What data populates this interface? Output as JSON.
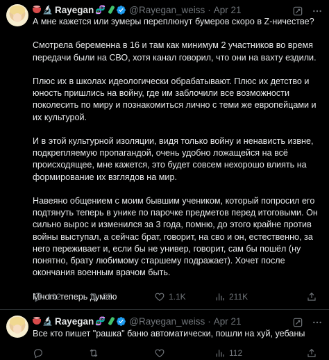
{
  "tweet1": {
    "display_name": "Rayegan",
    "handle": "@Rayegan_weiss",
    "separator": "·",
    "date": "Apr 21",
    "paragraphs": [
      "А мне кажется или зумеры переплюнут бумеров скоро в Z-ничестве?",
      "Смотрела беременна в 16 и там как минимум 2 участников во время передачи были на СВО, хотя канал говорил, что они на вахту ездили.",
      "Плюс их в школах идеологически обрабатывают. Плюс их детство и юность пришлись на войну, где им заблочили все возможности поколесить по миру и познакомиться лично с теми же европейцами и их культурой.",
      "И в этой культурной изоляции, видя только войну и ненависть извне, подкрепляемую пропагандой, очень удобно ложащейся на всё происходящее, мне кажется, это будет совсем нехорошо влиять на формирование их взглядов на мир.",
      "Навеяно общением с моим бывшим учеником, который попросил его подтянуть теперь в унике по парочке предметов перед итоговыми. Он сильно вырос и изменился за 3 года, помню, до этого крайне против войны выступал, а сейчас брат, говорит, на сво и он, естественно, за него переживает и, если бы не универ, говорит, сам бы пошёл (ну понятно, брату любимому старшему подражает). Хочет после окончания военным врачом быть.",
      "Много теперь думаю"
    ],
    "replies": "192",
    "reposts": "57",
    "likes": "1.1K",
    "views": "211K"
  },
  "tweet2": {
    "display_name": "Rayegan",
    "handle": "@Rayegan_weiss",
    "separator": "·",
    "date": "Apr 21",
    "text": "Все кто пишет \"рашка\" баню автоматически, пошли на хуй, уебаны",
    "replies": "",
    "reposts": "",
    "likes": "",
    "views": "112"
  },
  "icons": {
    "name_emojis": [
      "bowl-emoji",
      "microscope-emoji",
      "dna-emoji",
      "test-tube-emoji"
    ],
    "verified": "verified-badge-icon",
    "top_right": [
      "grok-icon",
      "more-icon"
    ],
    "actions": [
      "reply-icon",
      "repost-icon",
      "like-icon",
      "views-icon",
      "share-icon"
    ]
  },
  "colors": {
    "background": "#000000",
    "text": "#e7e9ea",
    "muted": "#71767b",
    "verified": "#1d9bf0",
    "divider": "#2f3336"
  }
}
